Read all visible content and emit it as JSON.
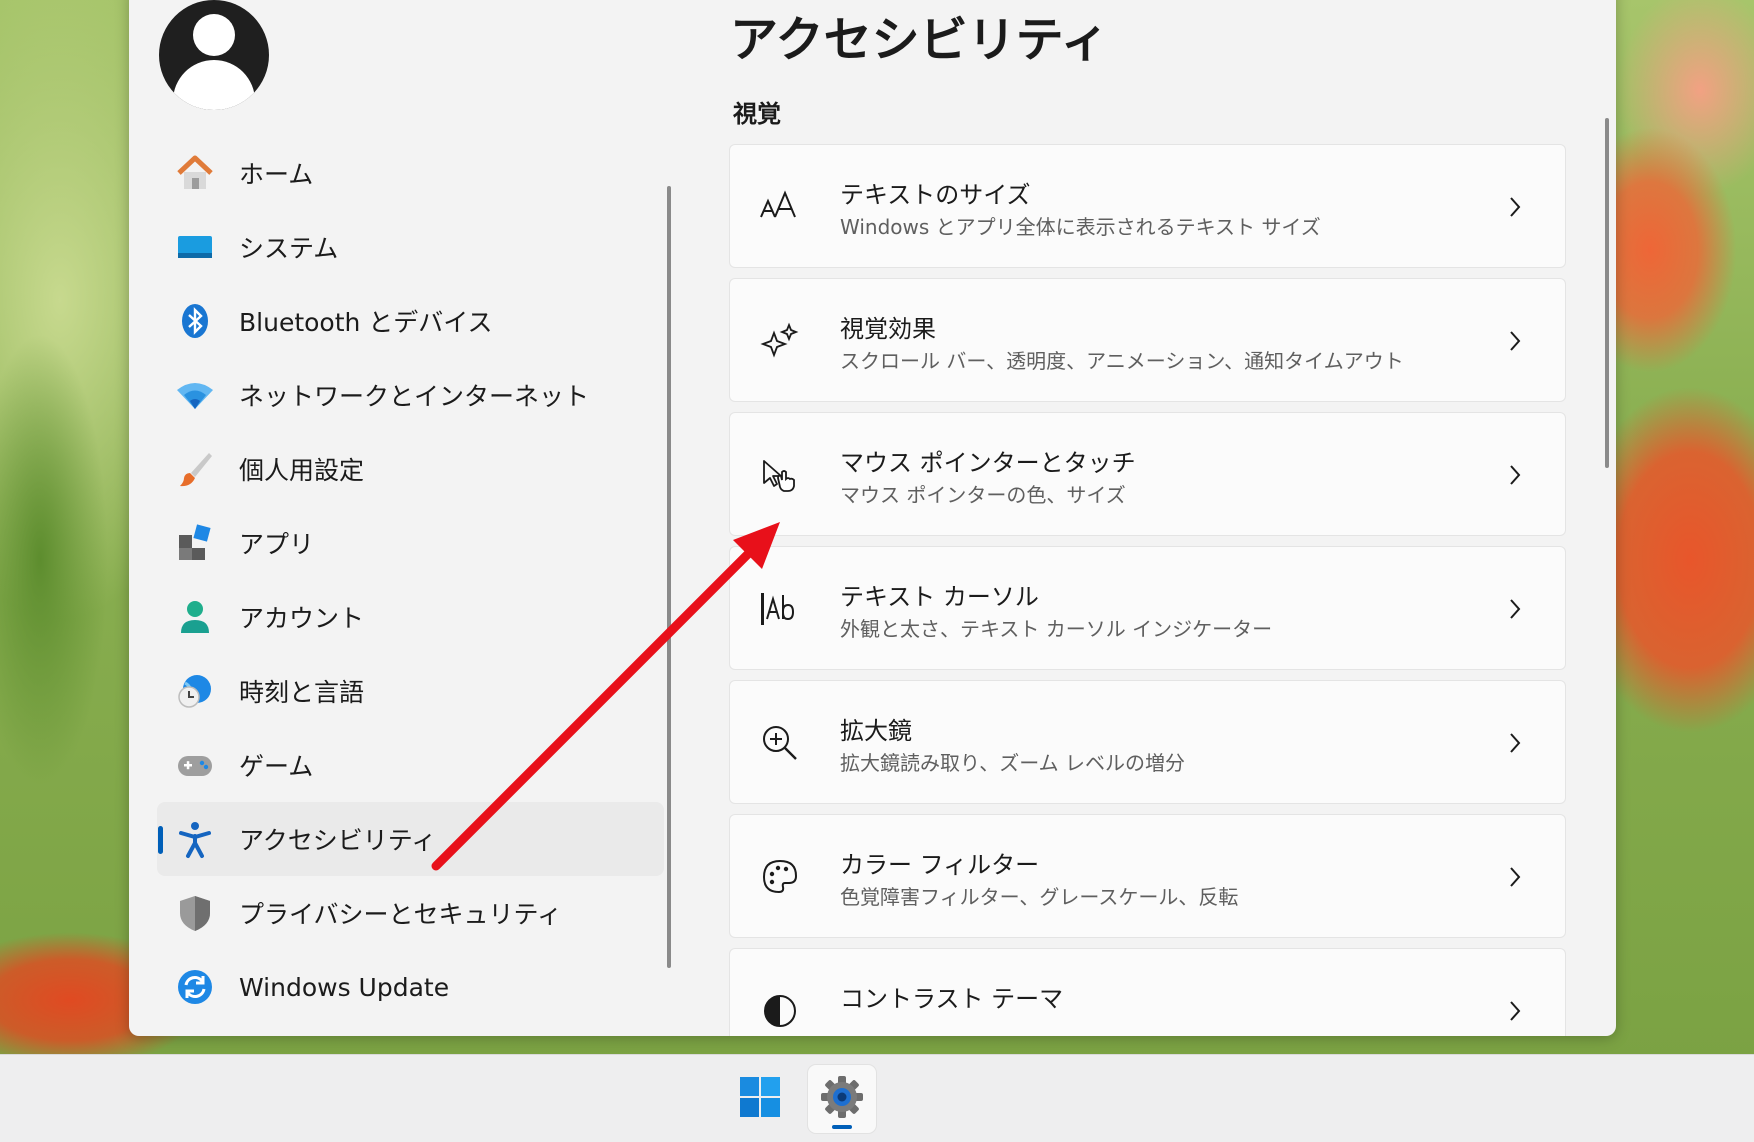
{
  "page": {
    "title": "アクセシビリティ",
    "section": "視覚"
  },
  "nav": {
    "items": [
      {
        "label": "ホーム",
        "icon": "home-icon"
      },
      {
        "label": "システム",
        "icon": "system-display-icon"
      },
      {
        "label": "Bluetooth とデバイス",
        "icon": "bluetooth-icon"
      },
      {
        "label": "ネットワークとインターネット",
        "icon": "wifi-icon"
      },
      {
        "label": "個人用設定",
        "icon": "brush-icon"
      },
      {
        "label": "アプリ",
        "icon": "apps-icon"
      },
      {
        "label": "アカウント",
        "icon": "account-icon"
      },
      {
        "label": "時刻と言語",
        "icon": "time-language-icon"
      },
      {
        "label": "ゲーム",
        "icon": "gamepad-icon"
      },
      {
        "label": "アクセシビリティ",
        "icon": "accessibility-icon",
        "selected": true
      },
      {
        "label": "プライバシーとセキュリティ",
        "icon": "shield-icon"
      },
      {
        "label": "Windows Update",
        "icon": "update-icon"
      }
    ]
  },
  "cards": [
    {
      "title": "テキストのサイズ",
      "desc": "Windows とアプリ全体に表示されるテキスト サイズ",
      "icon": "text-size-icon"
    },
    {
      "title": "視覚効果",
      "desc": "スクロール バー、透明度、アニメーション、通知タイムアウト",
      "icon": "sparkle-icon"
    },
    {
      "title": "マウス ポインターとタッチ",
      "desc": "マウス ポインターの色、サイズ",
      "icon": "pointer-touch-icon"
    },
    {
      "title": "テキスト カーソル",
      "desc": "外観と太さ、テキスト カーソル インジケーター",
      "icon": "text-cursor-icon"
    },
    {
      "title": "拡大鏡",
      "desc": "拡大鏡読み取り、ズーム レベルの増分",
      "icon": "magnifier-icon"
    },
    {
      "title": "カラー フィルター",
      "desc": "色覚障害フィルター、グレースケール、反転",
      "icon": "palette-icon"
    },
    {
      "title": "コントラスト テーマ",
      "desc": "",
      "icon": "contrast-icon"
    }
  ],
  "colors": {
    "accent": "#005fb8",
    "annotation_arrow": "#e8101a"
  },
  "taskbar": {
    "items": [
      {
        "icon": "windows-start-icon"
      },
      {
        "icon": "settings-gear-icon",
        "active": true
      }
    ]
  }
}
